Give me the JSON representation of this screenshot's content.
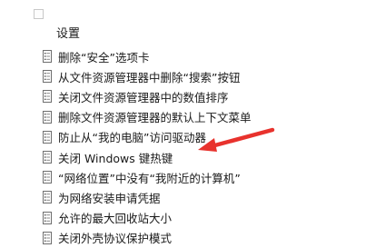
{
  "section_header": "设置",
  "policies": [
    {
      "label": "删除“安全”选项卡",
      "icon": "policy-setting-icon"
    },
    {
      "label": "从文件资源管理器中删除“搜索”按钮",
      "icon": "policy-setting-icon"
    },
    {
      "label": "关闭文件资源管理器中的数值排序",
      "icon": "policy-setting-icon"
    },
    {
      "label": "删除文件资源管理器的默认上下文菜单",
      "icon": "policy-setting-icon"
    },
    {
      "label": "防止从“我的电脑”访问驱动器",
      "icon": "policy-setting-icon"
    },
    {
      "label": "关闭 Windows 键热键",
      "icon": "policy-setting-icon"
    },
    {
      "label": "“网络位置”中没有“我附近的计算机”",
      "icon": "policy-setting-icon"
    },
    {
      "label": "为网络安装申请凭据",
      "icon": "policy-setting-icon"
    },
    {
      "label": "允许的最大回收站大小",
      "icon": "policy-setting-icon"
    },
    {
      "label": "关闭外壳协议保护模式",
      "icon": "policy-setting-icon"
    }
  ],
  "colors": {
    "annotation_arrow": "#e8322d",
    "text": "#1a1a1a",
    "background": "#ffffff"
  }
}
